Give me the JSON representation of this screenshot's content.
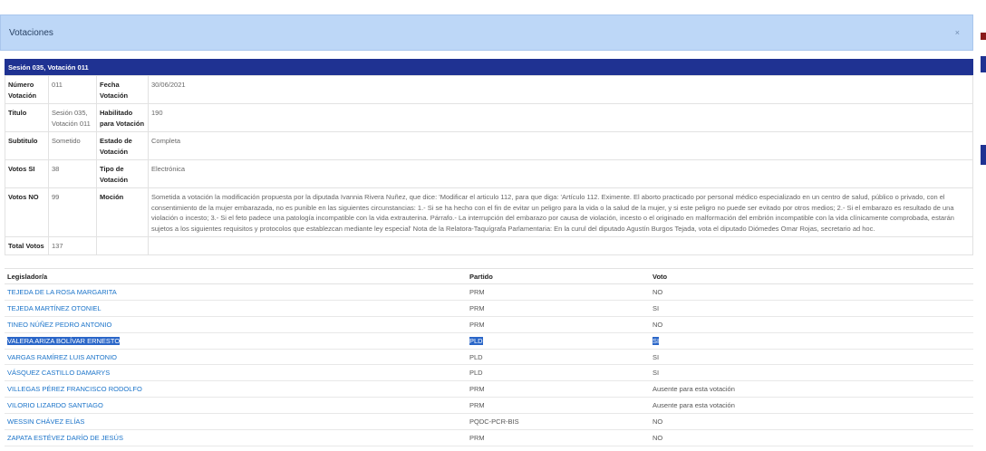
{
  "modal": {
    "title": "Votaciones",
    "close_label": "×"
  },
  "session_bar": "Sesión 035, Votación 011",
  "details": {
    "numero_label": "Número Votación",
    "numero": "011",
    "fecha_label": "Fecha Votación",
    "fecha": "30/06/2021",
    "titulo_label": "Titulo",
    "titulo": "Sesión 035, Votación 011",
    "habilitado_label": "Habilitado para Votación",
    "habilitado": "190",
    "subtitulo_label": "Subtitulo",
    "subtitulo": "Sometido",
    "estado_label": "Estado de Votación",
    "estado": "Completa",
    "votos_si_label": "Votos SI",
    "votos_si": "38",
    "tipo_label": "Tipo de Votación",
    "tipo": "Electrónica",
    "votos_no_label": "Votos NO",
    "votos_no": "99",
    "mocion_label": "Moción",
    "mocion": "Sometida a votación la modificación propuesta por la diputada Ivannia Rivera Nuñez, que dice: 'Modificar el articulo 112, para que diga: 'Artículo 112. Eximente. El aborto practicado por personal médico especializado en un centro de salud, público o privado, con el consentimiento de la mujer embarazada, no es punible en las siguientes circunstancias: 1.- Si se ha hecho con el fin de evitar un peligro para la vida o la salud de la mujer, y si este peligro no puede ser evitado por otros medios; 2.- Si el embarazo es resultado de una violación o incesto; 3.- Si el feto padece una patología incompatible con la vida extrauterina. Párrafo.- La interrupción del embarazo por causa de violación, incesto o el originado en malformación del embrión incompatible con la vida clínicamente comprobada, estarán sujetos a los siguientes requisitos y protocolos que establezcan mediante ley especial' Nota de la Relatora-Taquígrafa Parlamentaria: En la curul del diputado Agustín Burgos Tejada, vota el diputado Diómedes Omar Rojas, secretario ad hoc.",
    "total_label": "Total Votos",
    "total": "137"
  },
  "voters_table": {
    "headers": {
      "legislador": "Legislador/a",
      "partido": "Partido",
      "voto": "Voto"
    },
    "rows": [
      {
        "name": "TEJEDA DE LA ROSA MARGARITA",
        "party": "PRM",
        "vote": "NO"
      },
      {
        "name": "TEJEDA MARTÍNEZ OTONIEL",
        "party": "PRM",
        "vote": "SI"
      },
      {
        "name": "TINEO NÚÑEZ PEDRO ANTONIO",
        "party": "PRM",
        "vote": "NO"
      },
      {
        "name": "VALERA ARIZA BOLÍVAR ERNESTO",
        "party": "PLD",
        "vote": "SI"
      },
      {
        "name": "VARGAS RAMÍREZ LUIS ANTONIO",
        "party": "PLD",
        "vote": "SI"
      },
      {
        "name": "VÁSQUEZ CASTILLO DAMARYS",
        "party": "PLD",
        "vote": "SI"
      },
      {
        "name": "VILLEGAS PÉREZ FRANCISCO RODOLFO",
        "party": "PRM",
        "vote": "Ausente para esta votación"
      },
      {
        "name": "VILORIO LIZARDO SANTIAGO",
        "party": "PRM",
        "vote": "Ausente para esta votación"
      },
      {
        "name": "WESSIN CHÁVEZ ELÍAS",
        "party": "PQDC-PCR-BIS",
        "vote": "NO"
      },
      {
        "name": "ZAPATA ESTÉVEZ DARÍO DE JESÚS",
        "party": "PRM",
        "vote": "NO"
      }
    ]
  },
  "colors": {
    "header_bg": "#bdd7f7",
    "session_bar_bg": "#1f3292",
    "link": "#1a73c9",
    "selection": "#2a66c8"
  }
}
